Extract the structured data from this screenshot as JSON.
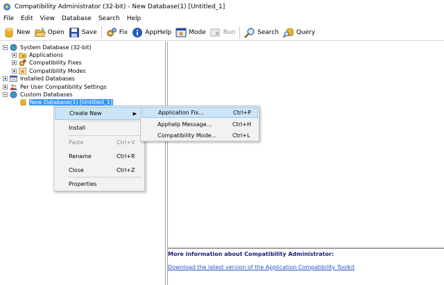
{
  "window": {
    "title": "Compatibility Administrator (32-bit) - New Database(1) [Untitled_1]"
  },
  "menubar": [
    "File",
    "Edit",
    "View",
    "Database",
    "Search",
    "Help"
  ],
  "toolbar": {
    "new": "New",
    "open": "Open",
    "save": "Save",
    "fix": "Fix",
    "apphelp": "AppHelp",
    "mode": "Mode",
    "run": "Run",
    "search": "Search",
    "query": "Query"
  },
  "tree": {
    "system_db": "System Database (32-bit)",
    "applications": "Applications",
    "compat_fixes": "Compatibility Fixes",
    "compat_modes": "Compatibility Modes",
    "installed_db": "Installed Databases",
    "per_user": "Per User Compatibility Settings",
    "custom_db": "Custom Databases",
    "new_db": "New Database(1) [Untitled_1]"
  },
  "context_menu": {
    "create_new": "Create New",
    "install": "Install",
    "paste": "Paste",
    "paste_shortcut": "Ctrl+V",
    "rename": "Rename",
    "rename_shortcut": "Ctrl+R",
    "close": "Close",
    "close_shortcut": "Ctrl+Z",
    "properties": "Properties"
  },
  "submenu": {
    "app_fix": "Application Fix...",
    "app_fix_shortcut": "Ctrl+P",
    "apphelp_msg": "Apphelp Message...",
    "apphelp_msg_shortcut": "Ctrl+H",
    "compat_mode": "Compatibility Mode...",
    "compat_mode_shortcut": "Ctrl+L"
  },
  "info": {
    "title": "More information about Compatibility Administrator:",
    "link": "Download the latest version of the Application Compatibility Toolkit"
  },
  "colors": {
    "selection": "#3399ff",
    "menu_hover": "#cce4f7",
    "link": "#2a50c8",
    "info_title": "#1a1a7a"
  }
}
